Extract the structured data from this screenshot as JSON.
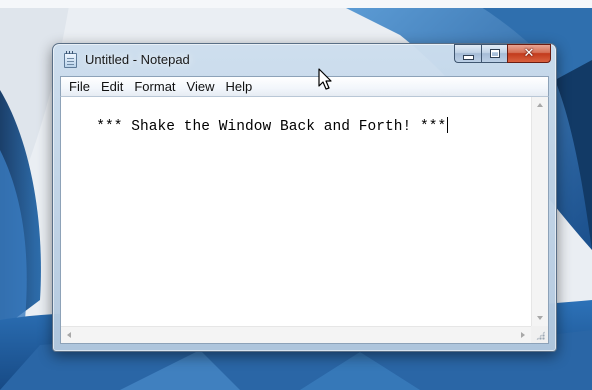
{
  "window": {
    "title": "Untitled - Notepad",
    "caption_buttons": {
      "minimize": "minimize",
      "maximize": "maximize",
      "close": "✕"
    }
  },
  "menu": [
    {
      "label": "File"
    },
    {
      "label": "Edit"
    },
    {
      "label": "Format"
    },
    {
      "label": "View"
    },
    {
      "label": "Help"
    }
  ],
  "editor": {
    "text": "   *** Shake the Window Back and Forth! ***"
  },
  "colors": {
    "desktop_blue": "#1f5f9e",
    "desktop_light": "#e9eef4",
    "close_red": "#c23a1c",
    "frame_blue": "#b2c8de"
  }
}
